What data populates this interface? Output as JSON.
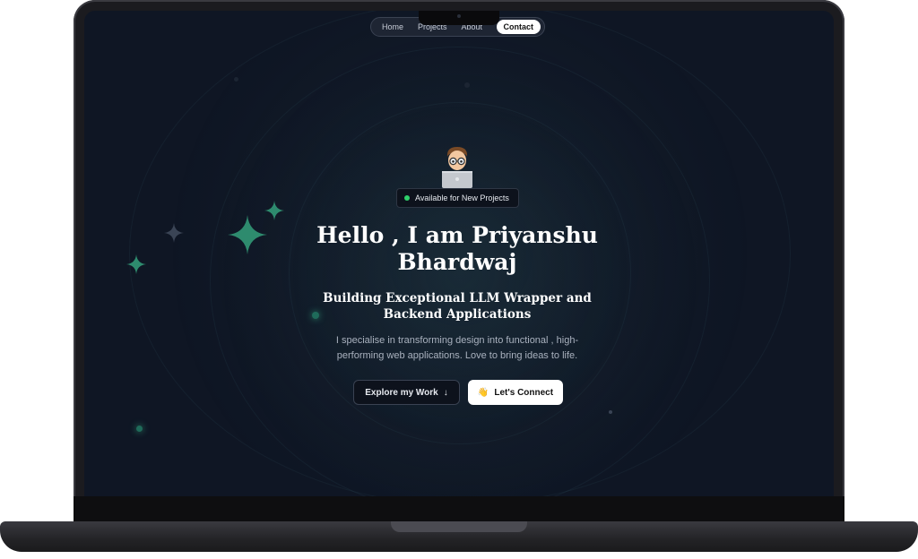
{
  "nav": {
    "items": [
      "Home",
      "Projects",
      "About"
    ],
    "active": "Contact"
  },
  "hero": {
    "badge": "Available for New Projects",
    "title_line1": "Hello , I am Priyanshu",
    "title_line2": "Bhardwaj",
    "subtitle_line1": "Building Exceptional LLM Wrapper and",
    "subtitle_line2": "Backend Applications",
    "description_line1": "I specialise in transforming design into functional , high-",
    "description_line2": "performing web applications. Love to bring ideas to life."
  },
  "buttons": {
    "explore": "Explore my Work",
    "explore_icon": "↓",
    "connect": "Let's Connect",
    "connect_icon": "👋"
  },
  "colors": {
    "background": "#0f1624",
    "sparkle": "#2e8b6e",
    "status": "#2fd06b"
  },
  "icons": {
    "avatar": "memoji-laptop-avatar",
    "status": "green-dot-icon"
  }
}
